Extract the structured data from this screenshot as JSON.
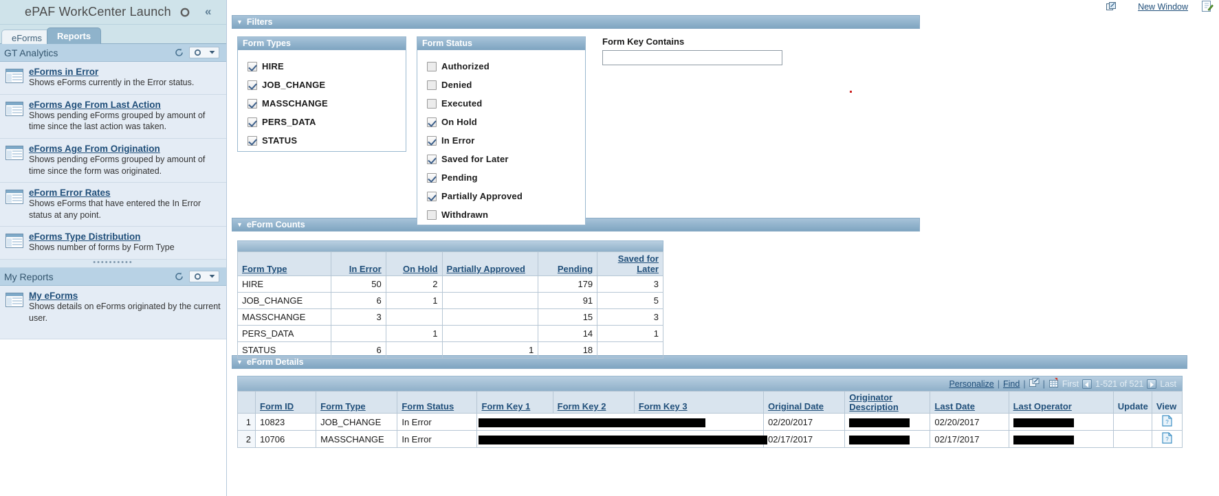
{
  "workcenter": {
    "title": "ePAF WorkCenter Launch",
    "gear_icon": "gear-icon",
    "collapse_icon": "collapse-chevron-icon",
    "tabs": [
      {
        "label": "eForms",
        "active": false
      },
      {
        "label": "Reports",
        "active": true
      }
    ]
  },
  "groups": [
    {
      "title": "GT Analytics",
      "refresh_icon": "refresh-icon",
      "actions_icon": "gear-dropdown-icon",
      "reports": [
        {
          "link": "eForms in Error",
          "desc": "Shows eForms currently in the Error status."
        },
        {
          "link": "eForms Age From Last Action",
          "desc": "Shows pending eForms grouped by amount of time since the last action was taken."
        },
        {
          "link": "eForms Age From Origination",
          "desc": "Shows pending eForms grouped by amount of time since the form was originated."
        },
        {
          "link": "eForm Error Rates",
          "desc": "Shows eForms that have entered the In Error status at any point."
        },
        {
          "link": "eForms Type Distribution",
          "desc": "Shows number of forms by Form Type"
        }
      ]
    },
    {
      "title": "My Reports",
      "refresh_icon": "refresh-icon",
      "actions_icon": "gear-dropdown-icon",
      "reports": [
        {
          "link": "My eForms",
          "desc": "Shows details on eForms originated by the current user."
        }
      ]
    }
  ],
  "topbar": {
    "new_window": "New Window",
    "new_window_icon": "new-window-icon",
    "edit_icon": "edit-page-icon"
  },
  "sections": {
    "filters": "Filters",
    "counts": "eForm Counts",
    "details": "eForm Details"
  },
  "filters": {
    "form_types": {
      "title": "Form Types",
      "options": [
        {
          "label": "HIRE",
          "checked": true
        },
        {
          "label": "JOB_CHANGE",
          "checked": true
        },
        {
          "label": "MASSCHANGE",
          "checked": true
        },
        {
          "label": "PERS_DATA",
          "checked": true
        },
        {
          "label": "STATUS",
          "checked": true
        }
      ]
    },
    "form_status": {
      "title": "Form Status",
      "options": [
        {
          "label": "Authorized",
          "checked": false
        },
        {
          "label": "Denied",
          "checked": false
        },
        {
          "label": "Executed",
          "checked": false
        },
        {
          "label": "On Hold",
          "checked": true
        },
        {
          "label": "In Error",
          "checked": true
        },
        {
          "label": "Saved for Later",
          "checked": true
        },
        {
          "label": "Pending",
          "checked": true
        },
        {
          "label": "Partially Approved",
          "checked": true
        },
        {
          "label": "Withdrawn",
          "checked": false
        }
      ]
    },
    "form_key_contains": {
      "label": "Form Key Contains",
      "value": "",
      "placeholder": ""
    }
  },
  "counts_table": {
    "columns": [
      "Form Type",
      "In Error",
      "On Hold",
      "Partially Approved",
      "Pending",
      "Saved for Later"
    ],
    "rows": [
      {
        "form_type": "HIRE",
        "in_error": "50",
        "on_hold": "2",
        "partially_approved": "",
        "pending": "179",
        "saved_for_later": "3"
      },
      {
        "form_type": "JOB_CHANGE",
        "in_error": "6",
        "on_hold": "1",
        "partially_approved": "",
        "pending": "91",
        "saved_for_later": "5"
      },
      {
        "form_type": "MASSCHANGE",
        "in_error": "3",
        "on_hold": "",
        "partially_approved": "",
        "pending": "15",
        "saved_for_later": "3"
      },
      {
        "form_type": "PERS_DATA",
        "in_error": "",
        "on_hold": "1",
        "partially_approved": "",
        "pending": "14",
        "saved_for_later": "1"
      },
      {
        "form_type": "STATUS",
        "in_error": "6",
        "on_hold": "",
        "partially_approved": "1",
        "pending": "18",
        "saved_for_later": ""
      }
    ]
  },
  "details": {
    "nav": {
      "personalize": "Personalize",
      "find": "Find",
      "export_icon": "export-excel-icon",
      "grid_icon": "download-grid-icon",
      "first": "First",
      "prev_icon": "previous-page-icon",
      "range": "1-521 of 521",
      "next_icon": "next-page-icon",
      "last": "Last"
    },
    "columns": [
      "Form ID",
      "Form Type",
      "Form Status",
      "Form Key 1",
      "Form Key 2",
      "Form Key 3",
      "Original Date",
      "Originator Description",
      "Last Date",
      "Last Operator",
      "Update",
      "View"
    ],
    "rows": [
      {
        "n": "1",
        "form_id": "10823",
        "form_type": "JOB_CHANGE",
        "form_status": "In Error",
        "form_key_1": "",
        "form_key_2": "",
        "form_key_3": "",
        "original_date": "02/20/2017",
        "originator_description": "",
        "last_date": "02/20/2017",
        "last_operator": "",
        "update": "",
        "view_icon": "view-form-icon",
        "redacted": {
          "key_span_w": 330,
          "orig_desc_w": 88,
          "last_op_w": 88
        }
      },
      {
        "n": "2",
        "form_id": "10706",
        "form_type": "MASSCHANGE",
        "form_status": "In Error",
        "form_key_1": "",
        "form_key_2": "",
        "form_key_3": "",
        "original_date": "02/17/2017",
        "originator_description": "",
        "last_date": "02/17/2017",
        "last_operator": "",
        "update": "",
        "view_icon": "view-form-icon",
        "redacted": {
          "key_span_w": 420,
          "orig_desc_w": 88,
          "last_op_w": 88
        }
      }
    ]
  },
  "colors": {
    "header_bg": "#cfe3ea",
    "accent_bar": "#8fb0c9",
    "link": "#1f4e79",
    "group_bg": "#b8d2e5",
    "report_bg": "#e4ecf5"
  }
}
